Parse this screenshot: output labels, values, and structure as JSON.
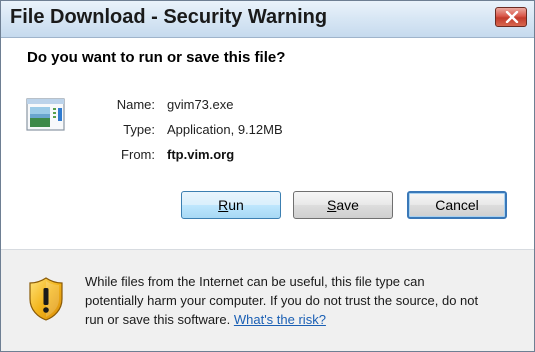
{
  "window": {
    "title": "File Download - Security Warning"
  },
  "dialog": {
    "question": "Do you want to run or save this file?",
    "file": {
      "name_label": "Name:",
      "name_value": "gvim73.exe",
      "type_label": "Type:",
      "type_value": "Application, 9.12MB",
      "from_label": "From:",
      "from_value": "ftp.vim.org"
    },
    "buttons": {
      "run": {
        "mnemonic": "R",
        "rest": "un"
      },
      "save": {
        "mnemonic": "S",
        "rest": "ave"
      },
      "cancel": "Cancel"
    },
    "warning": {
      "line1": "While files from the Internet can be useful, this file type can",
      "line2": "potentially harm your computer. If you do not trust the source, do not",
      "line3": "run or save this software.",
      "link": "What's the risk?"
    }
  },
  "icons": {
    "close": "close-icon",
    "file": "application-file-icon",
    "warning": "warning-shield-icon"
  },
  "colors": {
    "link": "#1a5fb4",
    "titlebar": "#d7e6f4",
    "close_button": "#c23b2c",
    "footer": "#f0f0f0"
  }
}
